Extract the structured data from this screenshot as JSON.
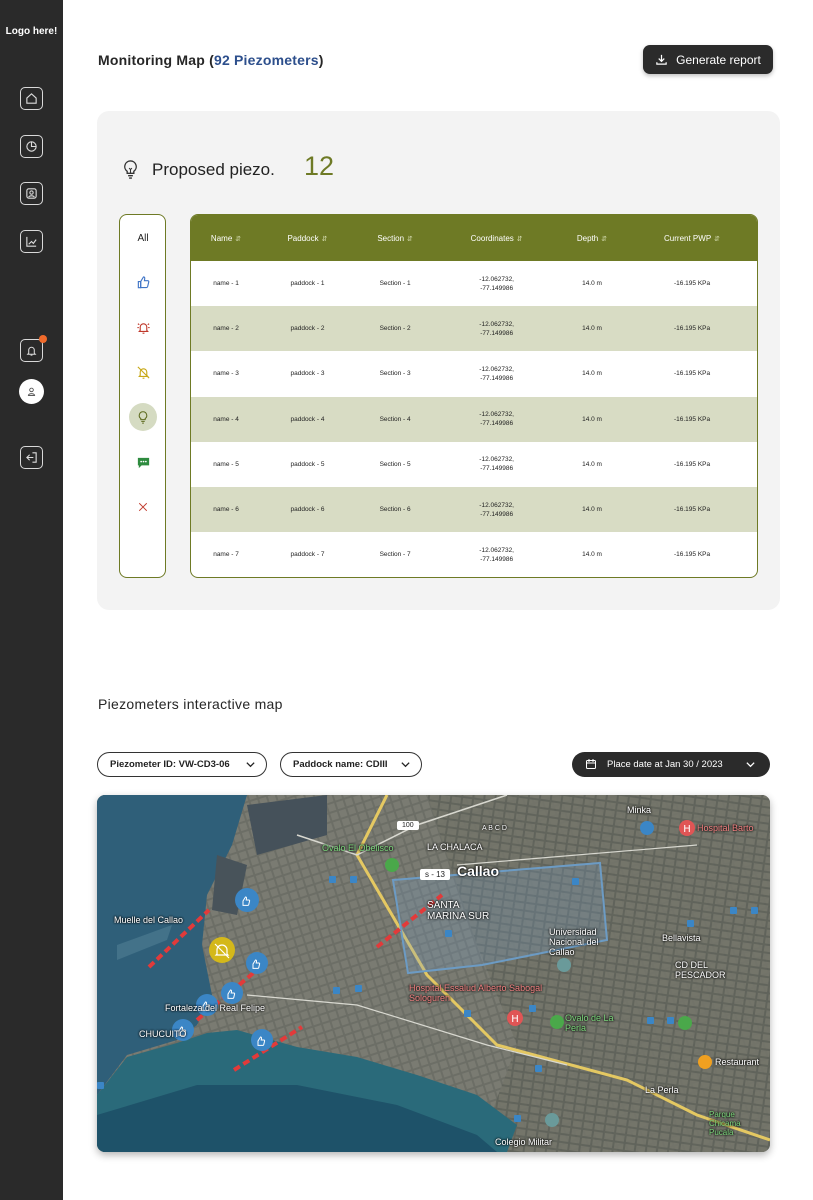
{
  "sidebar": {
    "logo": "Logo here!"
  },
  "header": {
    "title": "Monitoring Map (",
    "count": "92 Piezometers",
    "title_end": ")",
    "report_button": "Generate report"
  },
  "proposed": {
    "label": "Proposed piezo.",
    "count": "12"
  },
  "filters": {
    "all": "All"
  },
  "table": {
    "headers": [
      "Name",
      "Paddock",
      "Section",
      "Coordinates",
      "Depth",
      "Current PWP"
    ],
    "rows": [
      {
        "name": "name - 1",
        "paddock": "paddock - 1",
        "section": "Section - 1",
        "coord1": "-12.062732,",
        "coord2": "-77.149986",
        "depth": "14.0 m",
        "pwp": "-16.195 KPa"
      },
      {
        "name": "name - 2",
        "paddock": "paddock - 2",
        "section": "Section - 2",
        "coord1": "-12.062732,",
        "coord2": "-77.149986",
        "depth": "14.0 m",
        "pwp": "-16.195 KPa"
      },
      {
        "name": "name - 3",
        "paddock": "paddock - 3",
        "section": "Section - 3",
        "coord1": "-12.062732,",
        "coord2": "-77.149986",
        "depth": "14.0 m",
        "pwp": "-16.195 KPa"
      },
      {
        "name": "name - 4",
        "paddock": "paddock - 4",
        "section": "Section - 4",
        "coord1": "-12.062732,",
        "coord2": "-77.149986",
        "depth": "14.0 m",
        "pwp": "-16.195 KPa"
      },
      {
        "name": "name - 5",
        "paddock": "paddock - 5",
        "section": "Section - 5",
        "coord1": "-12.062732,",
        "coord2": "-77.149986",
        "depth": "14.0 m",
        "pwp": "-16.195 KPa"
      },
      {
        "name": "name - 6",
        "paddock": "paddock - 6",
        "section": "Section - 6",
        "coord1": "-12.062732,",
        "coord2": "-77.149986",
        "depth": "14.0 m",
        "pwp": "-16.195 KPa"
      },
      {
        "name": "name - 7",
        "paddock": "paddock - 7",
        "section": "Section - 7",
        "coord1": "-12.062732,",
        "coord2": "-77.149986",
        "depth": "14.0 m",
        "pwp": "-16.195 KPa"
      }
    ]
  },
  "map_section": {
    "title": "Piezometers interactive map",
    "piezometer_filter": "Piezometer ID: VW-CD3-06",
    "paddock_filter": "Paddock name: CDIII",
    "date_filter": "Place date at Jan 30 / 2023",
    "section_tag": "s - 13",
    "labels": {
      "callao": "Callao",
      "la_chalaca": "LA CHALACA",
      "santa_marina": "SANTA MARINA SUR",
      "ovalo_obelisco": "Ovalo El Obelisco",
      "muelle": "Muelle del Callao",
      "fortaleza": "Fortaleza del Real Felipe",
      "chucuito": "CHUCUITO",
      "hospital_essalud": "Hospital Essalud Alberto Sabogal Sologuren",
      "universidad": "Universidad Nacional del Callao",
      "bellavista": "Bellavista",
      "ciudad_pescador": "CD DEL PESCADOR",
      "ovalo_perla": "Ovalo de La Perla",
      "la_perla": "La Perla",
      "minka": "Minka",
      "hospital_barton": "Hospital Barto",
      "restaurant": "Restaurant",
      "colegio": "Colegio Militar",
      "parque": "Parque Chicama Pucala",
      "abcd": "A B C D",
      "road_100": "100"
    }
  },
  "colors": {
    "olive": "#6e7a25",
    "row_alt": "#d8dcc4",
    "dark": "#2b2b2b",
    "accent_blue": "#2d4f8c",
    "notification": "#f06a2b"
  }
}
